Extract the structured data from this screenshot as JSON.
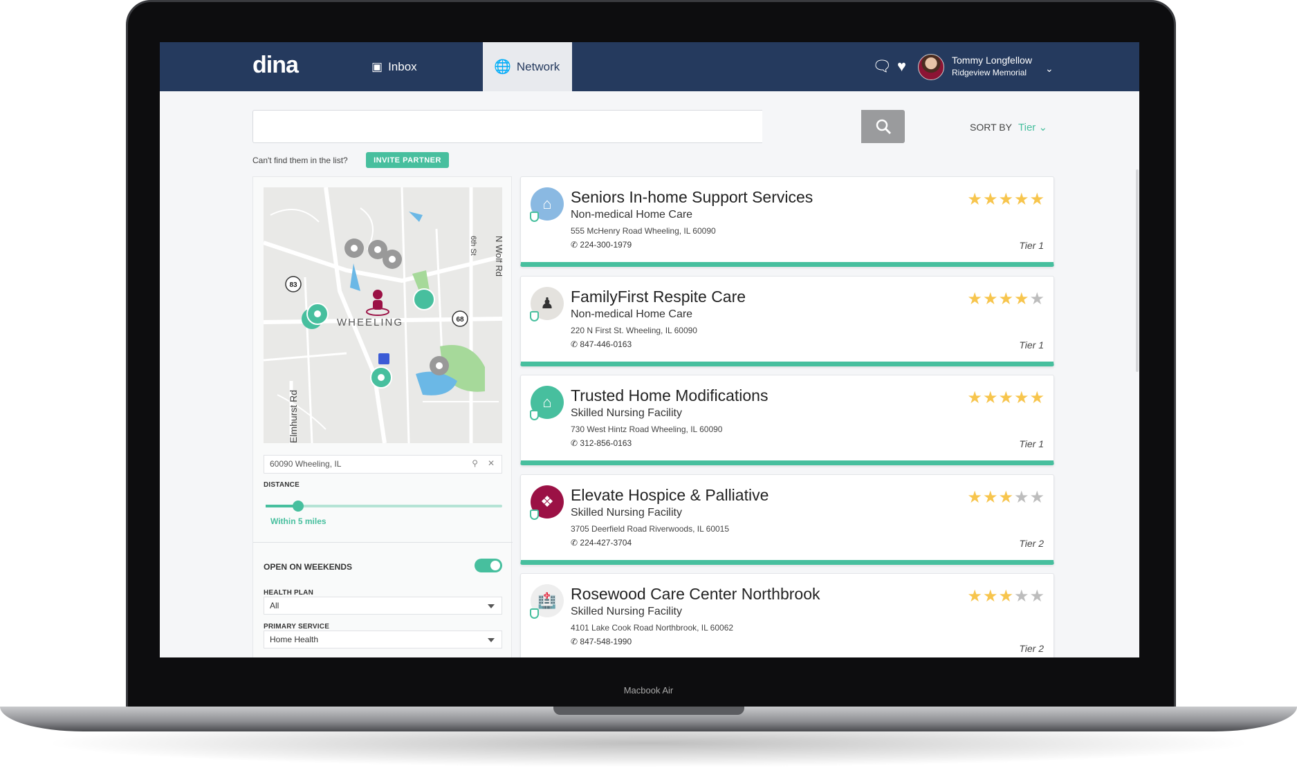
{
  "device": {
    "label": "Macbook Air"
  },
  "nav": {
    "logo": "dina",
    "tabs": [
      {
        "label": "Inbox",
        "icon": "inbox-icon"
      },
      {
        "label": "Network",
        "icon": "globe-icon",
        "active": true
      }
    ],
    "icons": [
      "chat-icon",
      "heart-pulse-icon"
    ],
    "user": {
      "name": "Tommy Longfellow",
      "org": "Ridgeview Memorial"
    }
  },
  "search": {
    "value": "",
    "placeholder": ""
  },
  "sort": {
    "label": "SORT BY",
    "value": "Tier"
  },
  "invite": {
    "text": "Can't find them in the list?",
    "button": "INVITE PARTNER"
  },
  "filters": {
    "map_labels": [
      "WHEELING",
      "83",
      "68",
      "N Wolf Rd",
      "6th St",
      "Elmhurst Rd"
    ],
    "location": "60090 Wheeling, IL",
    "distance_label": "DISTANCE",
    "distance_value": "Within 5 miles",
    "distance_fraction": 0.14,
    "weekends_label": "OPEN ON WEEKENDS",
    "weekends_on": true,
    "health_plan_label": "HEALTH PLAN",
    "health_plan": "All",
    "primary_service_label": "PRIMARY SERVICE",
    "primary_service": "Home Health"
  },
  "colors": {
    "nav": "#253a5e",
    "accent": "#47bf9e",
    "star": "#f7c54d",
    "star_empty": "#bdbdbd"
  },
  "providers": [
    {
      "name": "Seniors In-home Support Services",
      "type": "Non-medical Home Care",
      "address": "555 McHenry Road Wheeling, IL 60090",
      "phone": "224-300-1979",
      "rating": 5,
      "tier": "Tier 1",
      "icon": "house-icon",
      "icon_color": "#8ab9e2"
    },
    {
      "name": "FamilyFirst Respite Care",
      "type": "Non-medical Home Care",
      "address": "220 N First St. Wheeling, IL 60090",
      "phone": "847-446-0163",
      "rating": 4,
      "tier": "Tier 1",
      "icon": "family-icon",
      "icon_color": "#e4e2de"
    },
    {
      "name": "Trusted Home Modifications",
      "type": "Skilled Nursing Facility",
      "address": "730 West Hintz Road Wheeling, IL 60090",
      "phone": "312-856-0163",
      "rating": 5,
      "tier": "Tier 1",
      "icon": "home-repair-icon",
      "icon_color": "#47bf9e"
    },
    {
      "name": "Elevate Hospice & Palliative",
      "type": "Skilled Nursing Facility",
      "address": "3705 Deerfield Road Riverwoods, IL 60015",
      "phone": "224-427-3704",
      "rating": 3,
      "tier": "Tier 2",
      "icon": "hospice-icon",
      "icon_color": "#9b1145"
    },
    {
      "name": "Rosewood Care Center Northbrook",
      "type": "Skilled Nursing Facility",
      "address": "4101 Lake Cook Road Northbrook, IL 60062",
      "phone": "847-548-1990",
      "rating": 3,
      "tier": "Tier 2",
      "icon": "hospital-icon",
      "icon_color": "#eeeeee"
    }
  ]
}
